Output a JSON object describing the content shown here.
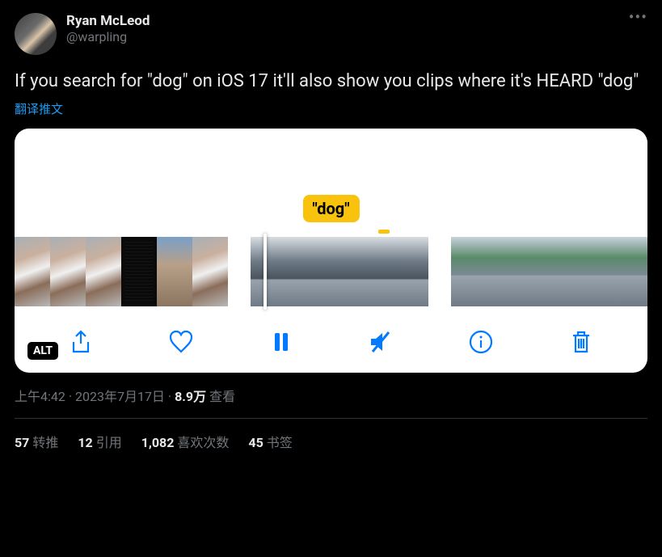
{
  "user": {
    "display_name": "Ryan McLeod",
    "handle": "@warpling"
  },
  "tweet_text": "If you search for \"dog\" on iOS 17 it'll also show you clips where it's HEARD \"dog\"",
  "translate_label": "翻译推文",
  "media": {
    "chip_label": "\"dog\"",
    "alt_badge": "ALT"
  },
  "meta": {
    "time": "上午4:42",
    "dot1": " · ",
    "date": "2023年7月17日",
    "dot2": " · ",
    "views_count": "8.9万",
    "views_label": " 查看"
  },
  "stats": {
    "retweets_count": "57",
    "retweets_label": "转推",
    "quotes_count": "12",
    "quotes_label": "引用",
    "likes_count": "1,082",
    "likes_label": "喜欢次数",
    "bookmarks_count": "45",
    "bookmarks_label": "书签"
  }
}
